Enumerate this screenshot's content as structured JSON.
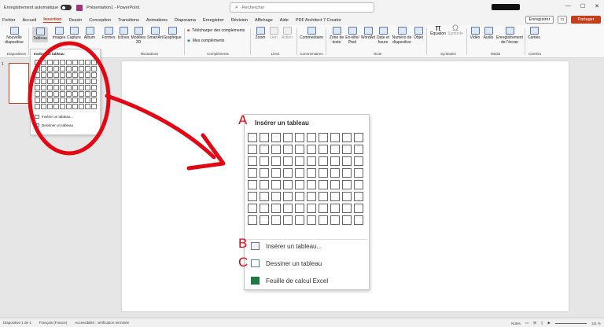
{
  "titlebar": {
    "autosave_label": "Enregistrement automatique",
    "doc_title": "Présentation1 - PowerPoint",
    "search_placeholder": "Rechercher"
  },
  "menubar": {
    "items": [
      "Fichier",
      "Accueil",
      "Insertion",
      "Dessin",
      "Conception",
      "Transitions",
      "Animations",
      "Diaporama",
      "Enregistrer",
      "Révision",
      "Affichage",
      "Aide",
      "PDF Architect 7 Creator"
    ],
    "active": "Insertion",
    "save_btn": "Enregistrer",
    "share_btn": "Partager"
  },
  "ribbon": {
    "buttons": {
      "nouvelle": "Nouvelle diapositive",
      "tableau": "Tableau",
      "images": "Images",
      "capture": "Capture",
      "album": "Album",
      "formes": "Formes",
      "icones": "Icônes",
      "modeles3d": "Modèles 3D",
      "smartart": "SmartArt",
      "graphique": "Graphique",
      "telecharger": "Télécharger des compléments",
      "mes_complements": "Mes compléments",
      "zoom": "Zoom",
      "lien": "Lien",
      "action": "Action",
      "commentaire": "Commentaire",
      "zone_texte": "Zone de texte",
      "entete": "En-tête/ Pied",
      "wordart": "WordArt",
      "date": "Date et heure",
      "numero": "Numéro de diapositive",
      "objet": "Objet",
      "equation": "Équation",
      "symbole": "Symbole",
      "video": "Vidéo",
      "audio": "Audio",
      "enregistrement": "Enregistrement de l'écran",
      "cameo": "Cameo"
    },
    "groups": {
      "diapositives": "Diapositives",
      "illustrations": "Illustrations",
      "complements": "Compléments",
      "liens": "Liens",
      "commentaires": "Commentaires",
      "texte": "Texte",
      "symboles": "Symboles",
      "media": "Média",
      "camera": "Caméra"
    }
  },
  "thumbnail": {
    "number": "1"
  },
  "small_dropdown": {
    "title": "Insérer un tableau",
    "item_insert": "Insérer un tableau...",
    "item_draw": "Dessiner un tableau"
  },
  "big_dropdown": {
    "title": "Insérer un tableau",
    "item_insert": "Insérer un tableau...",
    "item_draw": "Dessiner un tableau",
    "item_excel": "Feuille de calcul Excel"
  },
  "annotations": {
    "a": "A",
    "b": "B",
    "c": "C"
  },
  "statusbar": {
    "slide_info": "Diapositive 1 de 1",
    "language": "Français (France)",
    "accessibility": "Accessibilité : vérification terminée",
    "notes": "Notes",
    "zoom": "111 %"
  }
}
